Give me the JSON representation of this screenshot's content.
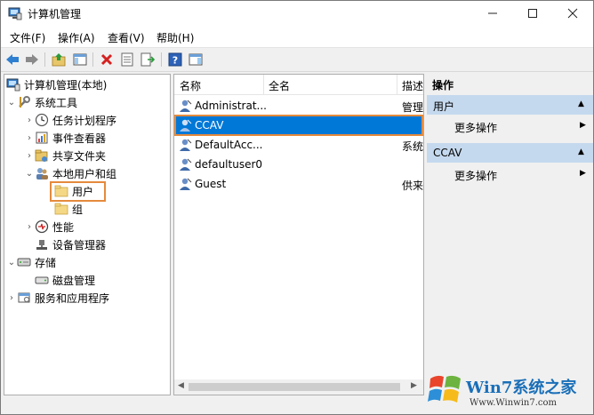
{
  "window": {
    "title": "计算机管理"
  },
  "menu": [
    "文件(F)",
    "操作(A)",
    "查看(V)",
    "帮助(H)"
  ],
  "tree": {
    "root": "计算机管理(本地)",
    "system_tools": "系统工具",
    "task_scheduler": "任务计划程序",
    "event_viewer": "事件查看器",
    "shared_folders": "共享文件夹",
    "local_users_groups": "本地用户和组",
    "users": "用户",
    "groups": "组",
    "performance": "性能",
    "device_manager": "设备管理器",
    "storage": "存储",
    "disk_management": "磁盘管理",
    "services_apps": "服务和应用程序"
  },
  "list": {
    "columns": [
      "名称",
      "全名",
      "描述"
    ],
    "rows": [
      {
        "name": "Administrat...",
        "desc": "管理"
      },
      {
        "name": "CCAV",
        "desc": ""
      },
      {
        "name": "DefaultAcc...",
        "desc": "系统"
      },
      {
        "name": "defaultuser0",
        "desc": ""
      },
      {
        "name": "Guest",
        "desc": "供来"
      }
    ]
  },
  "actions": {
    "header": "操作",
    "section1": "用户",
    "more1": "更多操作",
    "section2": "CCAV",
    "more2": "更多操作"
  },
  "watermark": {
    "brand": "Win7系统之家",
    "url": "Www.Winwin7.com"
  },
  "colors": {
    "selection": "#0078d7",
    "highlight_box": "#e48a3c",
    "action_section": "#c5d9ee"
  }
}
